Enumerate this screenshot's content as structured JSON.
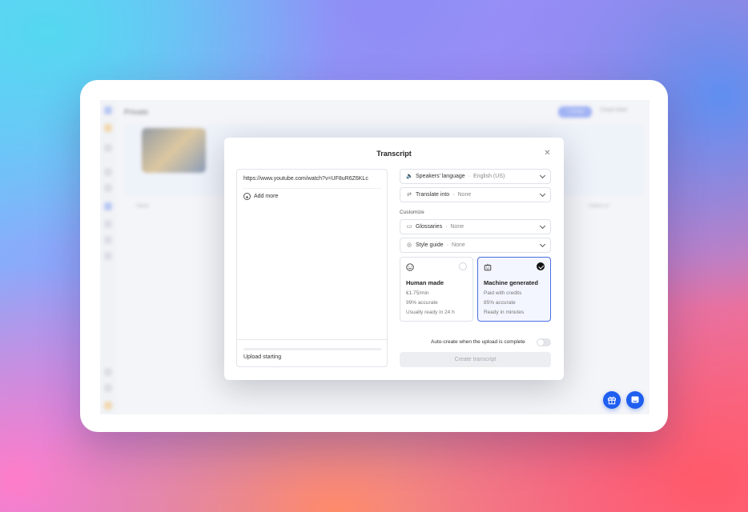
{
  "background_app": {
    "title": "Private",
    "primary_button": "+ Create",
    "secondary_link": "Create folder",
    "row_label_name": "Name",
    "row_label_date": "Added on"
  },
  "modal": {
    "title": "Transcript",
    "close_icon": "close-icon",
    "url_value": "https://www.youtube.com/watch?v=UF8uR6Z6KLc",
    "add_more_label": "Add more",
    "upload_status": "Upload starting",
    "upload_progress": 0.0,
    "speakers_language": {
      "label": "Speakers' language",
      "sep": "·",
      "value": "English (US)"
    },
    "translate_into": {
      "label": "Translate into",
      "sep": "·",
      "value": "None"
    },
    "customize_label": "Customize",
    "glossaries": {
      "label": "Glossaries",
      "sep": "·",
      "value": "None"
    },
    "style_guide": {
      "label": "Style guide",
      "sep": "·",
      "value": "None"
    },
    "options": [
      {
        "title": "Human made",
        "lines": [
          "€1.75/min",
          "99% accurate",
          "Usually ready in 24 h"
        ],
        "selected": false,
        "icon": "smiley-icon"
      },
      {
        "title": "Machine generated",
        "lines": [
          "Paid with credits",
          "85% accurate",
          "Ready in minutes"
        ],
        "selected": true,
        "icon": "robot-icon"
      }
    ],
    "auto_create_label": "Auto-create when the upload is complete",
    "auto_create_enabled": false,
    "create_button": "Create transcript"
  },
  "colors": {
    "accent": "#1f5ff0",
    "selected_border": "#4a6ee0",
    "selected_bg": "#f3f6ff"
  },
  "fabs": {
    "gift": "gift-icon",
    "chat": "chat-icon"
  }
}
